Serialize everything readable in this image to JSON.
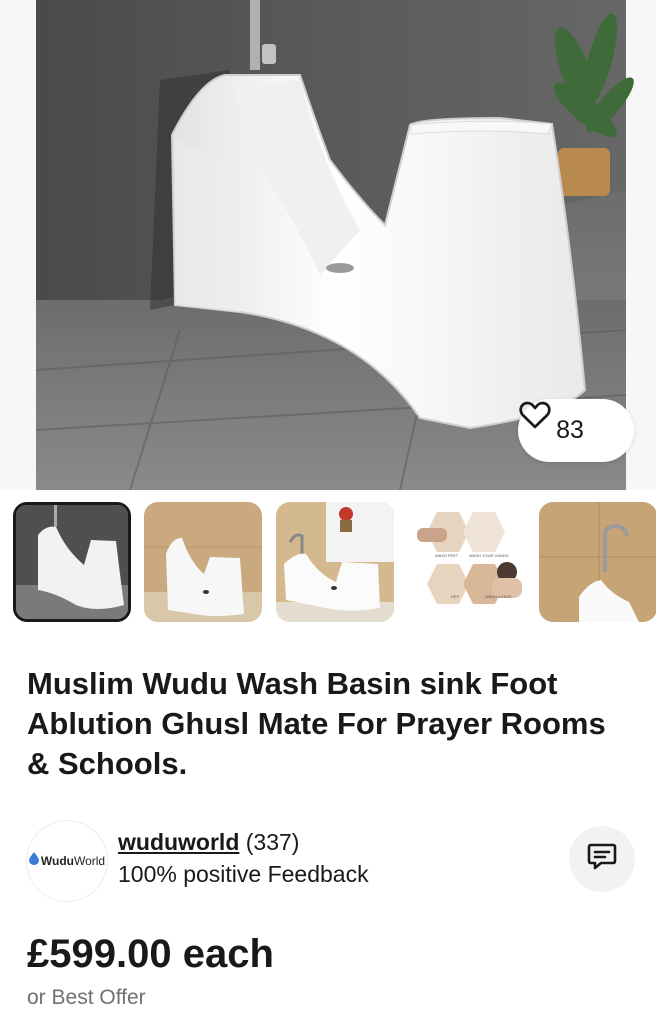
{
  "listing": {
    "title": "Muslim Wudu Wash Basin sink Foot Ablution Ghusl Mate For Prayer Rooms & Schools.",
    "watch_count": "83",
    "gallery": {
      "thumbnails": [
        {
          "label": "Ablution basin main photo",
          "selected": true
        },
        {
          "label": "Basin in beige tiled room",
          "selected": false
        },
        {
          "label": "Basin with faucet and flowers",
          "selected": false
        },
        {
          "label": "Usage step diagram",
          "selected": false
        },
        {
          "label": "Basin with tall faucet",
          "selected": false
        }
      ],
      "diagram_labels": [
        "WASH FEET",
        "WASH YOUR HANDS",
        "DRY",
        "WASH A FACE"
      ]
    }
  },
  "seller": {
    "logo_text_bold": "Wudu",
    "logo_text_light": "World",
    "name": "wuduworld",
    "feedback_count": "(337)",
    "feedback_text": "100% positive Feedback"
  },
  "price": {
    "amount": "£599.00 each",
    "best_offer": "or Best Offer"
  },
  "icons": {
    "watch": "heart-icon",
    "message": "message-bubble-icon",
    "logo": "water-drop-icon"
  },
  "colors": {
    "text": "#191919",
    "muted": "#707070",
    "logo_drop": "#3a7bd5"
  }
}
